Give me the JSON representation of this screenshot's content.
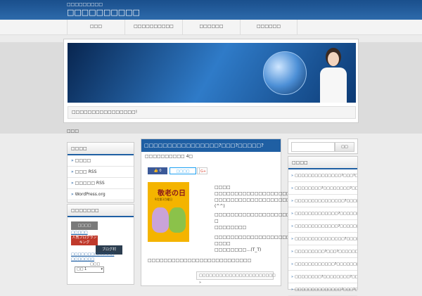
{
  "header": {
    "site_description": "□□□□□□□□□",
    "site_title": "□□□□□□□□□□"
  },
  "nav": {
    "items": [
      {
        "label": "□□□"
      },
      {
        "label": "□□□□□□□□□□"
      },
      {
        "label": "□□□□□□"
      },
      {
        "label": "□□□□□□"
      }
    ]
  },
  "hero": {
    "caption": "□□□□□□□□□□□□□□□□!"
  },
  "breadcrumb": "□□□",
  "left_sidebar": {
    "meta_title": "□□□□",
    "meta_links": [
      {
        "label": "□□□□"
      },
      {
        "label": "□□□ RSS"
      },
      {
        "label": "□□□□□ RSS"
      },
      {
        "label": "WordPress.org"
      }
    ],
    "ranking_title": "□□□□□□□",
    "banner_1": "□□□□",
    "link_1": "□□□□□",
    "banner_2": "人気ブログランキング",
    "banner_3": "ブログ村",
    "link_2": "□□□□□□□□□□□□□",
    "link_3": "□□□□□□□",
    "widget_label": "□□□",
    "select_value": "□□ 1"
  },
  "post": {
    "title": "□□□□□□□□□□□□□□□□?□□□?□□□□□?",
    "date": "□□□□□□□□□□ 4□",
    "social": {
      "like_count": "0",
      "tweet_label": "□□□□",
      "share_count": "0",
      "gplus_label": "G+"
    },
    "thumbnail_title": "敬老の日",
    "thumbnail_subtitle": "9月第3月曜日",
    "body_lines": [
      "□□□□",
      "□□□□□□□□□□□□□□□□□□□□□□□",
      "□□□□□□□□□□□□□□□□□□□□□",
      "(^^)",
      "□□□□□□□□□□□□□□□□□□□□□□",
      "□",
      "□□□□□□□□",
      "□□□□□□□□□□□□□□□□□□□□",
      "□□□□",
      "□□□□□□□□…(T_T)"
    ],
    "body_full_line": "□□□□□□□□□□□□□□□□□□□□□□□□□□",
    "read_more": "□□□□□□□□□□□□□□□□□□□□□□□ »"
  },
  "right_sidebar": {
    "search_button": "□□",
    "recent_title": "□□□□",
    "recent_posts": [
      {
        "label": "□□□□□□□□□□□□□□?□□□?□□□□?"
      },
      {
        "label": "□□□□□□□□?□□□□□□□□?□□□□□?"
      },
      {
        "label": "□□□□□□□□□□□□□□□?□□□□□?"
      },
      {
        "label": "□□□□□□□□□□□□□?□□□□□□□?"
      },
      {
        "label": "□□□□□□□□□□□□□?□□□□□□□?"
      },
      {
        "label": "□□□□□□□□□□□□□□□?□□□□□?"
      },
      {
        "label": "□□□□□□□□□?□□□?□□□□□□?"
      },
      {
        "label": "□□□□□□□□□□□□?□□□□□□□?"
      },
      {
        "label": "□□□□□□□□?□□□□□□□□?□□□□□?"
      },
      {
        "label": "□□□□□□□□□□□□□□?□□□?□□□□?"
      }
    ]
  },
  "colors": {
    "accent": "#1f5fa3",
    "header": "#1a4f8c"
  }
}
